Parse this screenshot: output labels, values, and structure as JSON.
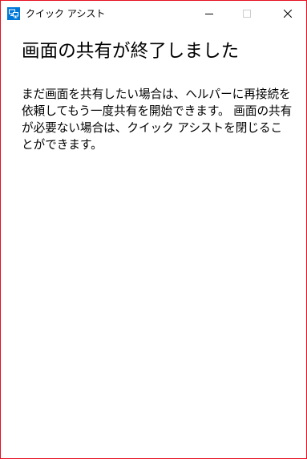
{
  "window": {
    "title": "クイック アシスト",
    "icon": "quick-assist-app-icon",
    "controls": {
      "minimize_icon": "minimize-icon",
      "maximize_icon": "maximize-icon",
      "close_icon": "close-icon"
    },
    "border_color": "#e81123"
  },
  "main": {
    "heading": "画面の共有が終了しました",
    "message": "まだ画面を共有したい場合は、ヘルパーに再接続を依頼してもう一度共有を開始できます。 画面の共有が必要ない場合は、クイック アシストを閉じることができます。"
  },
  "colors": {
    "accent": "#0078d7",
    "text": "#000000",
    "background": "#ffffff"
  }
}
